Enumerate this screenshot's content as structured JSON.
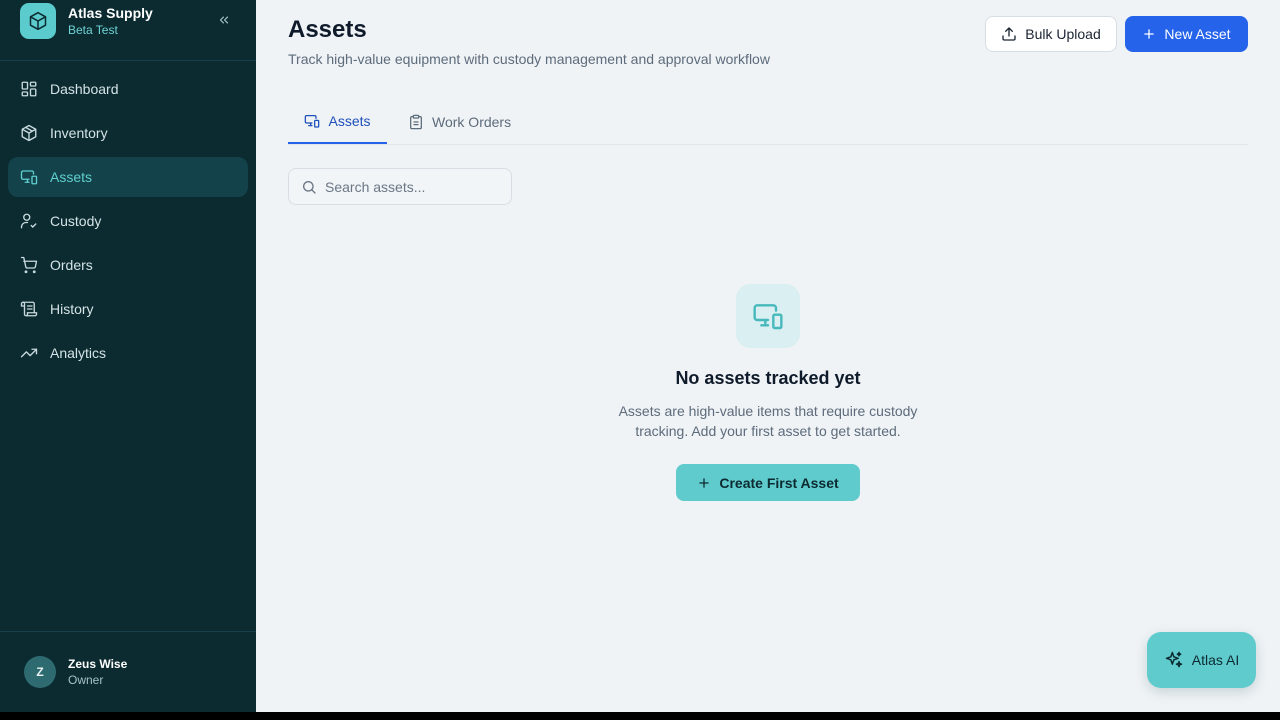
{
  "brand": {
    "name": "Atlas Supply",
    "subtitle": "Beta Test",
    "logo_icon": "cube-icon"
  },
  "sidebar": {
    "collapse_icon": "chevrons-left-icon",
    "items": [
      {
        "label": "Dashboard",
        "icon": "grid-icon"
      },
      {
        "label": "Inventory",
        "icon": "package-icon"
      },
      {
        "label": "Assets",
        "icon": "devices-icon",
        "active": true
      },
      {
        "label": "Custody",
        "icon": "user-check-icon"
      },
      {
        "label": "Orders",
        "icon": "cart-icon"
      },
      {
        "label": "History",
        "icon": "scroll-icon"
      },
      {
        "label": "Analytics",
        "icon": "trending-up-icon"
      }
    ]
  },
  "user": {
    "initial": "Z",
    "name": "Zeus Wise",
    "role": "Owner"
  },
  "header": {
    "title": "Assets",
    "subtitle": "Track high-value equipment with custody management and approval workflow",
    "bulk_upload_label": "Bulk Upload",
    "new_asset_label": "New Asset"
  },
  "tabs": [
    {
      "label": "Assets",
      "icon": "devices-icon",
      "active": true
    },
    {
      "label": "Work Orders",
      "icon": "clipboard-icon"
    }
  ],
  "search": {
    "placeholder": "Search assets...",
    "value": ""
  },
  "empty_state": {
    "icon": "devices-icon",
    "title": "No assets tracked yet",
    "description": "Assets are high-value items that require custody tracking. Add your first asset to get started.",
    "button_label": "Create First Asset"
  },
  "assistant": {
    "label": "Atlas AI",
    "icon": "sparkles-icon"
  },
  "colors": {
    "sidebar_bg": "#0b2b31",
    "accent_teal": "#5fcbcd",
    "primary_blue": "#2563eb",
    "main_bg": "#eff3f6"
  }
}
